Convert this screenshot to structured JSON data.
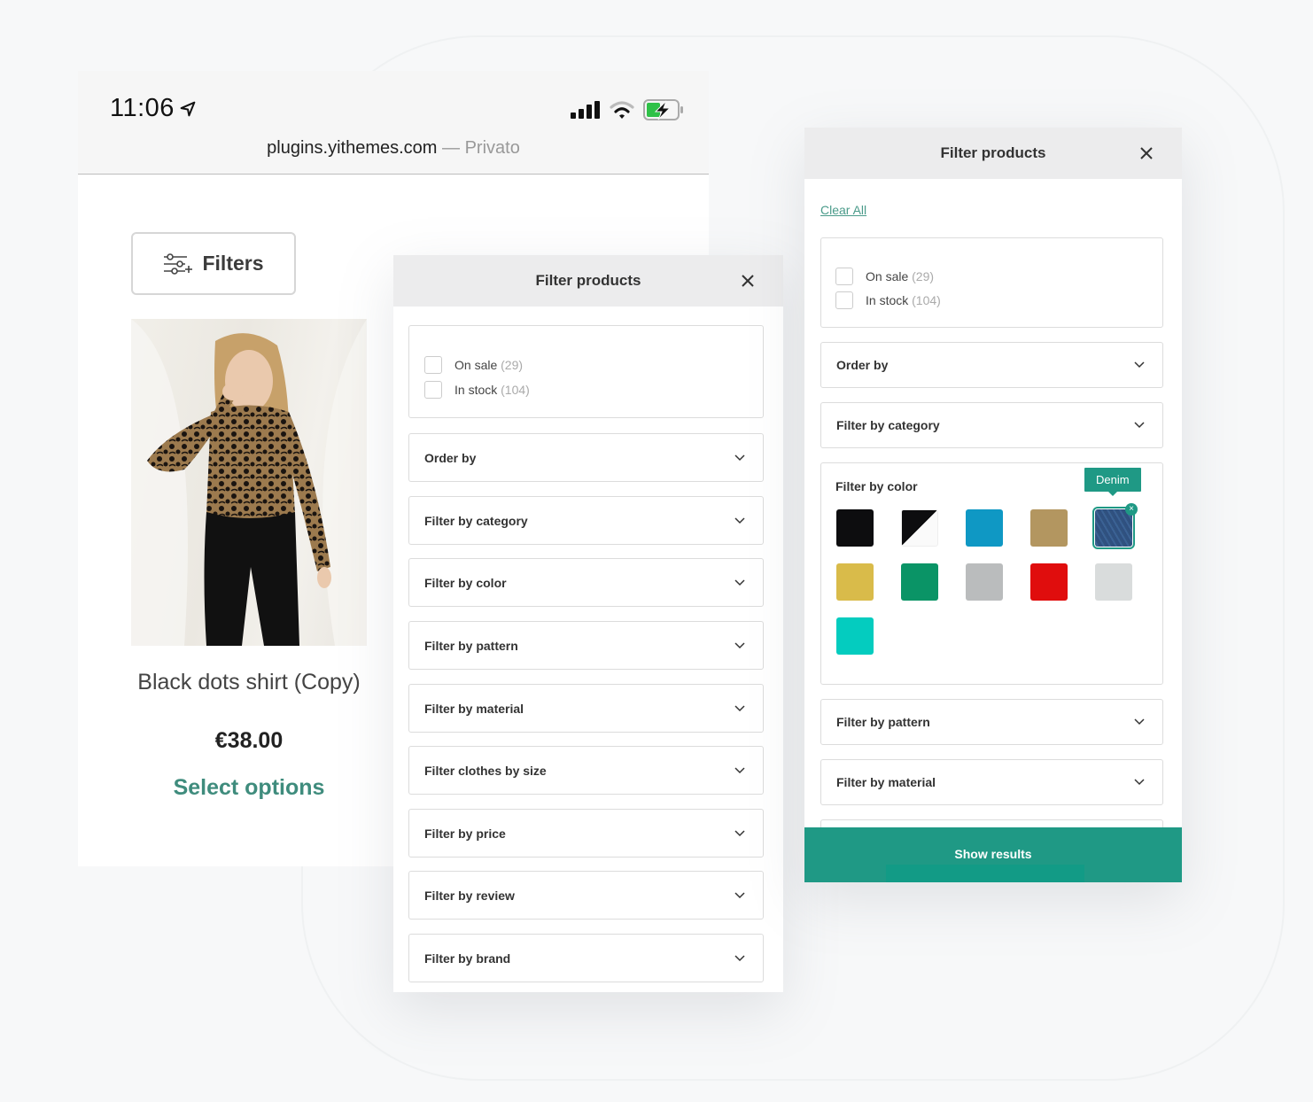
{
  "phone": {
    "status_bar": {
      "time": "11:06",
      "icons": [
        "location-arrow-icon",
        "signal-bars-icon",
        "wifi-icon",
        "battery-charging-icon"
      ]
    },
    "url": {
      "domain": "plugins.yithemes.com",
      "separator": " — ",
      "mode": "Privato"
    },
    "filters_button": {
      "label": "Filters",
      "icon": "sliders-icon"
    },
    "product": {
      "title": "Black dots shirt (Copy)",
      "price": "€38.00",
      "cta": "Select options"
    }
  },
  "panel_mid": {
    "title": "Filter products",
    "close_icon": "close-icon",
    "checkboxes": [
      {
        "label": "On sale",
        "count": "(29)",
        "checked": false
      },
      {
        "label": "In stock",
        "count": "(104)",
        "checked": false
      }
    ],
    "accordions": [
      {
        "label": "Order by"
      },
      {
        "label": "Filter by category"
      },
      {
        "label": "Filter by color"
      },
      {
        "label": "Filter by pattern"
      },
      {
        "label": "Filter by material"
      },
      {
        "label": "Filter clothes by size"
      },
      {
        "label": "Filter by price"
      },
      {
        "label": "Filter by review"
      },
      {
        "label": "Filter by brand"
      }
    ]
  },
  "panel_right": {
    "title": "Filter products",
    "close_icon": "close-icon",
    "clear_all": "Clear All",
    "checkboxes": [
      {
        "label": "On sale",
        "count": "(29)",
        "checked": false
      },
      {
        "label": "In stock",
        "count": "(104)",
        "checked": false
      }
    ],
    "accordions_top": [
      {
        "label": "Order by"
      },
      {
        "label": "Filter by category"
      }
    ],
    "color_filter": {
      "label": "Filter by color",
      "tooltip": "Denim",
      "remove_label": "×",
      "swatches": [
        {
          "name": "Black",
          "color": "#0d0d0f",
          "selected": false
        },
        {
          "name": "Black & White",
          "color": "split",
          "selected": false
        },
        {
          "name": "Blue",
          "color": "#0f98c4",
          "selected": false
        },
        {
          "name": "Beige",
          "color": "#b39660",
          "selected": false
        },
        {
          "name": "Denim",
          "color": "#35578a",
          "selected": true
        },
        {
          "name": "Yellow",
          "color": "#d9bb4a",
          "selected": false
        },
        {
          "name": "Green",
          "color": "#0a9466",
          "selected": false
        },
        {
          "name": "Grey",
          "color": "#babcbd",
          "selected": false
        },
        {
          "name": "Red",
          "color": "#e00d0d",
          "selected": false
        },
        {
          "name": "Light grey",
          "color": "#d9dcdc",
          "selected": false
        },
        {
          "name": "Turquoise",
          "color": "#04ccbf",
          "selected": false
        }
      ]
    },
    "accordions_bottom": [
      {
        "label": "Filter by pattern"
      },
      {
        "label": "Filter by material"
      }
    ],
    "show_results": "Show results"
  },
  "colors": {
    "accent": "#1f9985",
    "link": "#4a9b8a",
    "cta_text": "#3f8c7d"
  }
}
